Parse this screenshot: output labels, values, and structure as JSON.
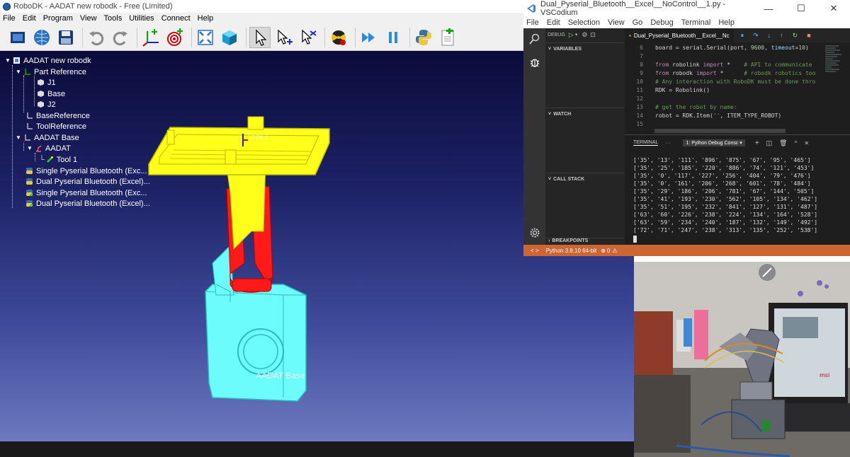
{
  "robodk": {
    "title": "RoboDK - AADAT new robodk - Free (Limited)",
    "menu": [
      "File",
      "Edit",
      "Program",
      "View",
      "Tools",
      "Utilities",
      "Connect",
      "Help"
    ],
    "toolbar_icons": [
      "new-station-icon",
      "web-open-icon",
      "save-icon",
      "undo-icon",
      "redo-icon",
      "add-reference-frame-icon",
      "add-target-icon",
      "fit-all-icon",
      "iso-view-icon",
      "select-icon",
      "move-reference-icon",
      "move-tool-icon",
      "collision-icon",
      "run-program-icon",
      "pause-icon",
      "python-icon",
      "add-program-icon"
    ],
    "tree": {
      "station": "AADAT new robodk",
      "part_reference": "Part Reference",
      "j1": "J1",
      "base": "Base",
      "j2": "J2",
      "base_reference": "BaseReference",
      "tool_reference": "ToolReference",
      "aadat_base": "AADAT Base",
      "aadat": "AADAT",
      "tool1": "Tool 1",
      "prog1": "Single Pyserial Bluetooth (Exc...",
      "prog2": "Dual Pyserial Bluetooth (Excel)...",
      "prog3": "Single Pyserial Bluetooth (Exc...",
      "prog4": "Dual Pyserial Bluetooth (Excel)..."
    },
    "viewport_labels": {
      "tool": "Tool 1",
      "base": "AADAT Base"
    },
    "colors": {
      "platform": "#f2f200",
      "arm": "#ff0000",
      "base": "#66ffff"
    }
  },
  "vscodium": {
    "title": "Dual_Pyserial_Bluetooth__Excel__NoControl__1.py - VSCodium",
    "menu": [
      "File",
      "Edit",
      "Selection",
      "View",
      "Go",
      "Debug",
      "Terminal",
      "Help"
    ],
    "debug_label": "DEBUG",
    "tab_label": "Dual_Pyserial_Bluetooth__Excel__Nc",
    "sidebar": {
      "variables": "VARIABLES",
      "watch": "WATCH",
      "call_stack": "CALL STACK",
      "breakpoints": "BREAKPOINTS"
    },
    "code": [
      {
        "n": "6",
        "text": "board = serial.Serial(port, 9600, timeout=10)"
      },
      {
        "n": "7",
        "text": ""
      },
      {
        "n": "8",
        "text": "from robolink import *    # API to communicate"
      },
      {
        "n": "9",
        "text": "from robodk import *      # robodk robotics too"
      },
      {
        "n": "10",
        "text": "# Any interaction with RoboDK must be done thro"
      },
      {
        "n": "11",
        "text": "RDK = Robolink()"
      },
      {
        "n": "12",
        "text": ""
      },
      {
        "n": "13",
        "text": "# get the robot by name:"
      },
      {
        "n": "14",
        "text": "robot = RDK.Item('', ITEM_TYPE_ROBOT)"
      },
      {
        "n": "15",
        "text": ""
      }
    ],
    "terminal": {
      "tab": "TERMINAL",
      "select": "1: Python Debug Consc",
      "lines": [
        "['35', '13', '111', '896', '875', '67', '95', '465']",
        "['35', '25', '185', '220', '886', '74', '121', '453']",
        "['35', '0', '117', '227', '256', '404', '79', '476']",
        "['35', '0', '161', '206', '268', '601', '78', '484']",
        "['35', '29', '186', '206', '781', '67', '144', '505']",
        "['35', '41', '193', '230', '562', '105', '134', '462']",
        "['35', '51', '195', '232', '841', '127', '131', '487']",
        "['63', '60', '226', '238', '224', '134', '164', '528']",
        "['63', '59', '234', '240', '187', '132', '149', '492']",
        "['72', '71', '247', '238', '313', '135', '252', '538']"
      ]
    },
    "status": {
      "python": "Python 3.8.10 64-bit",
      "errors": "0"
    }
  }
}
